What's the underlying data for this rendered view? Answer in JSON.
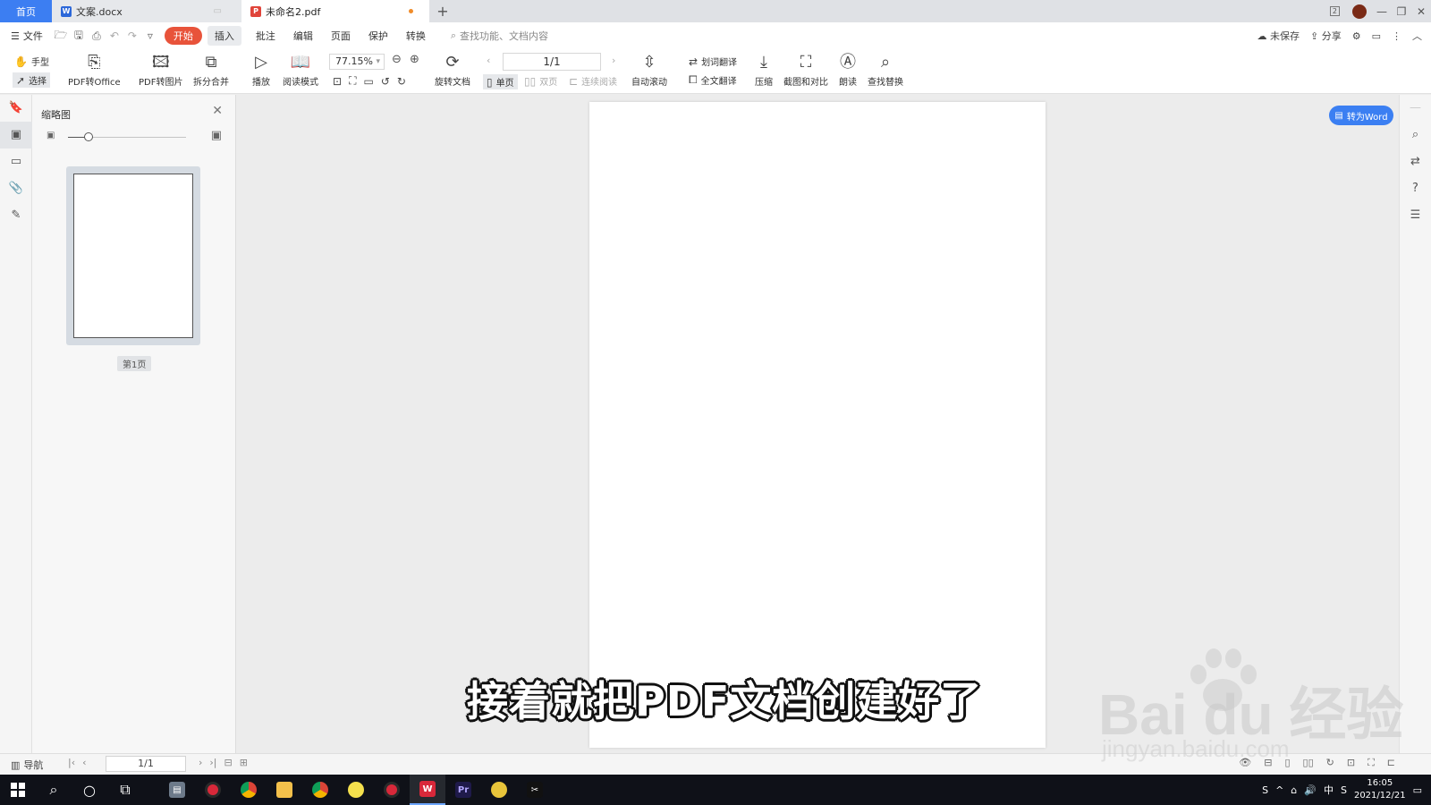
{
  "tabs": {
    "home": "首页",
    "doc": "文案.docx",
    "pdf": "未命名2.pdf",
    "new": "+"
  },
  "menu": {
    "file": "文件",
    "items": [
      "开始",
      "插入",
      "批注",
      "编辑",
      "页面",
      "保护",
      "转换"
    ],
    "search_placeholder": "查找功能、文档内容",
    "unsaved": "未保存",
    "share": "分享"
  },
  "toolbar": {
    "hand": "手型",
    "select": "选择",
    "pdf_to_office": "PDF转Office",
    "pdf_to_image": "PDF转图片",
    "split_merge": "拆分合并",
    "play": "播放",
    "read_mode": "阅读模式",
    "zoom": "77.15%",
    "rotate_doc": "旋转文档",
    "single_page": "单页",
    "double_page": "双页",
    "continuous": "连续阅读",
    "page_indicator": "1/1",
    "auto_scroll": "自动滚动",
    "word_translate": "划词翻译",
    "full_translate": "全文翻译",
    "compress": "压缩",
    "screenshot_compare": "截图和对比",
    "read_aloud": "朗读",
    "find_replace": "查找替换"
  },
  "thumb_panel": {
    "title": "缩略图",
    "page_label": "第1页"
  },
  "convert_button": "转为Word",
  "status": {
    "nav": "导航",
    "page": "1/1"
  },
  "subtitle": "接着就把PDF文档创建好了",
  "watermark": {
    "text": "Bai du 经验",
    "url": "jingyan.baidu.com"
  },
  "tray": {
    "ime": "中",
    "time": "16:05",
    "date": "2021/12/21"
  },
  "colors": {
    "accent": "#3c7ef2",
    "start_tab": "#e8533a",
    "taskbar": "#0f1118"
  }
}
